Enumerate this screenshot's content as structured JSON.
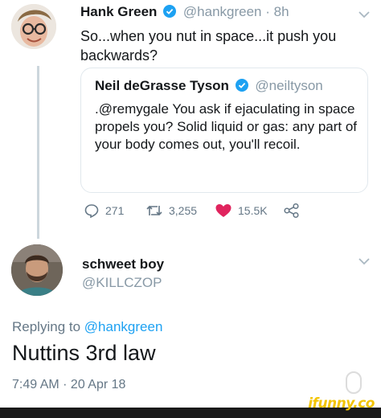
{
  "tweet": {
    "name": "Hank Green",
    "handle": "@hankgreen",
    "time": "· 8h",
    "text": "So...when you nut in space...it push you backwards?",
    "quoted": {
      "name": "Neil deGrasse Tyson",
      "handle": "@neiltyson",
      "text": ".@remygale You ask if ejaculating in space propels you? Solid liquid or gas: any part of your body comes out, you'll recoil."
    },
    "actions": {
      "replies": "271",
      "retweets": "3,255",
      "likes": "15.5K"
    },
    "colors": {
      "verified": "#1da1f2",
      "like": "#e0245e",
      "retweet": "#657786"
    }
  },
  "reply": {
    "name": "schweet boy",
    "handle": "@KILLCZOP",
    "replying_prefix": "Replying to",
    "replying_handle": "@hankgreen",
    "text": "Nuttins 3rd law",
    "timestamp": "7:49 AM · 20 Apr 18"
  },
  "watermark": {
    "text": "ifunny.co",
    "color": "#f3c400"
  }
}
